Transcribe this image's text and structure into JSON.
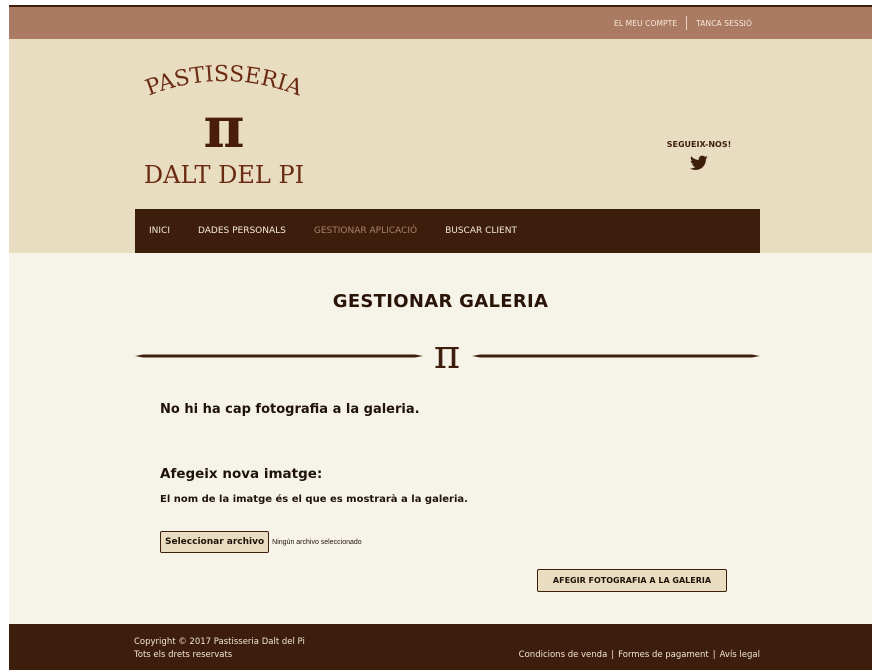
{
  "topbar": {
    "account_label": "EL MEU COMPTE",
    "logout_label": "TANCA SESSIÓ"
  },
  "logo": {
    "line1": "PASTISSERIA",
    "symbol": "π",
    "line2": "DALT DEL PI"
  },
  "social": {
    "follow_label": "SEGUEIX-NOS!",
    "icon": "twitter-icon"
  },
  "nav": {
    "items": [
      {
        "label": "INICI"
      },
      {
        "label": "DADES PERSONALS"
      },
      {
        "label": "GESTIONAR APLICACIÓ"
      },
      {
        "label": "BUSCAR CLIENT"
      }
    ]
  },
  "main": {
    "title": "GESTIONAR GALERIA",
    "divider_symbol": "π",
    "empty_message": "No hi ha cap fotografia a la galeria.",
    "add_heading": "Afegeix nova imatge:",
    "add_note": "El nom de la imatge és el que es mostrarà a la galeria.",
    "file_button_label": "Seleccionar archivo",
    "file_status": "Ningún archivo seleccionado",
    "submit_label": "AFEGIR FOTOGRAFIA A LA GALERIA"
  },
  "footer": {
    "copyright": "Copyright © 2017 Pastisseria Dalt del Pi",
    "rights": "Tots els drets reservats",
    "links": [
      {
        "label": "Condicions de venda"
      },
      {
        "label": "Formes de pagament"
      },
      {
        "label": "Avís legal"
      }
    ]
  },
  "colors": {
    "topbar": "#ab7a62",
    "header": "#e8dcc1",
    "dark_brown": "#3d1e0c",
    "main_bg": "#f6f4e8",
    "active_nav": "#a8806b"
  }
}
